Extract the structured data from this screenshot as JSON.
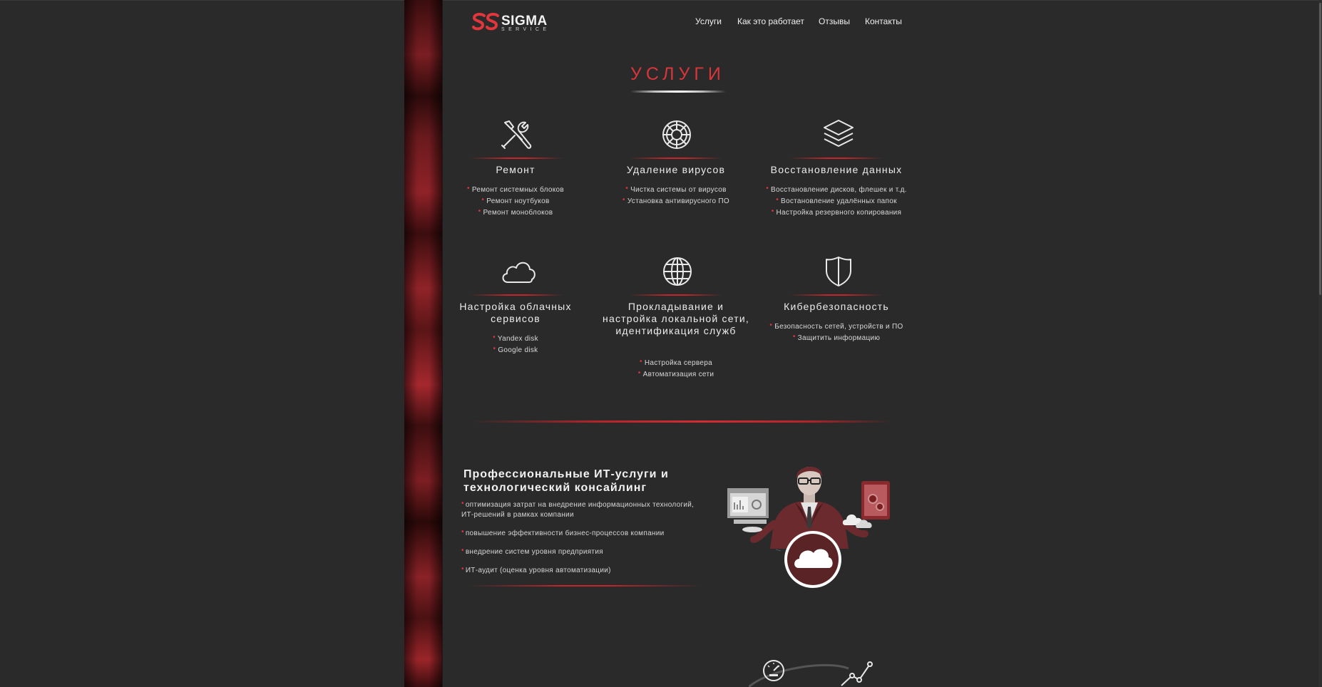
{
  "header": {
    "logo_word": "SIGMA",
    "logo_sub": "SERVICE",
    "nav": [
      "Услуги",
      "Как это работает",
      "Отзывы",
      "Контакты"
    ]
  },
  "services_title": "УСЛУГИ",
  "services": [
    {
      "name": "Ремонт",
      "icon": "tools-icon",
      "items": [
        "Ремонт системных блоков",
        "Ремонт ноутбуков",
        "Ремонт моноблоков"
      ]
    },
    {
      "name": "Удаление вирусов",
      "icon": "virus-icon",
      "items": [
        "Чистка системы от вирусов",
        "Установка антивирусного ПО"
      ]
    },
    {
      "name": "Восстановление данных",
      "icon": "layers-icon",
      "items": [
        "Восстановление дисков, флешек и т.д.",
        "Востановление удалённых папок",
        "Настройка резервного копирования"
      ]
    },
    {
      "name": "Настройка облачных сервисов",
      "icon": "cloud-icon",
      "items": [
        "Yandex disk",
        "Google disk"
      ]
    },
    {
      "name": "Прокладывание и настройка локальной сети, идентификация служб",
      "icon": "globe-icon",
      "items": [
        "Настройка сервера",
        "Автоматизация сети"
      ]
    },
    {
      "name": "Кибербезопасность",
      "icon": "shield-icon",
      "items": [
        "Безопасность сетей, устройств и ПО",
        "Защитить информацию"
      ]
    }
  ],
  "pro": {
    "title": "Профессиональные ИТ-услуги и технологический консайлинг",
    "items": [
      "оптимизация затрат на внедрение информационных технологий, ИТ-решений в рамках компании",
      "повышение эффективности бизнес-процессов компании",
      "внедрение систем уровня предприятия",
      "ИТ-аудит (оценка уровня автоматизации)"
    ]
  },
  "colors": {
    "accent": "#d9353b",
    "background": "#2a2a2a"
  }
}
